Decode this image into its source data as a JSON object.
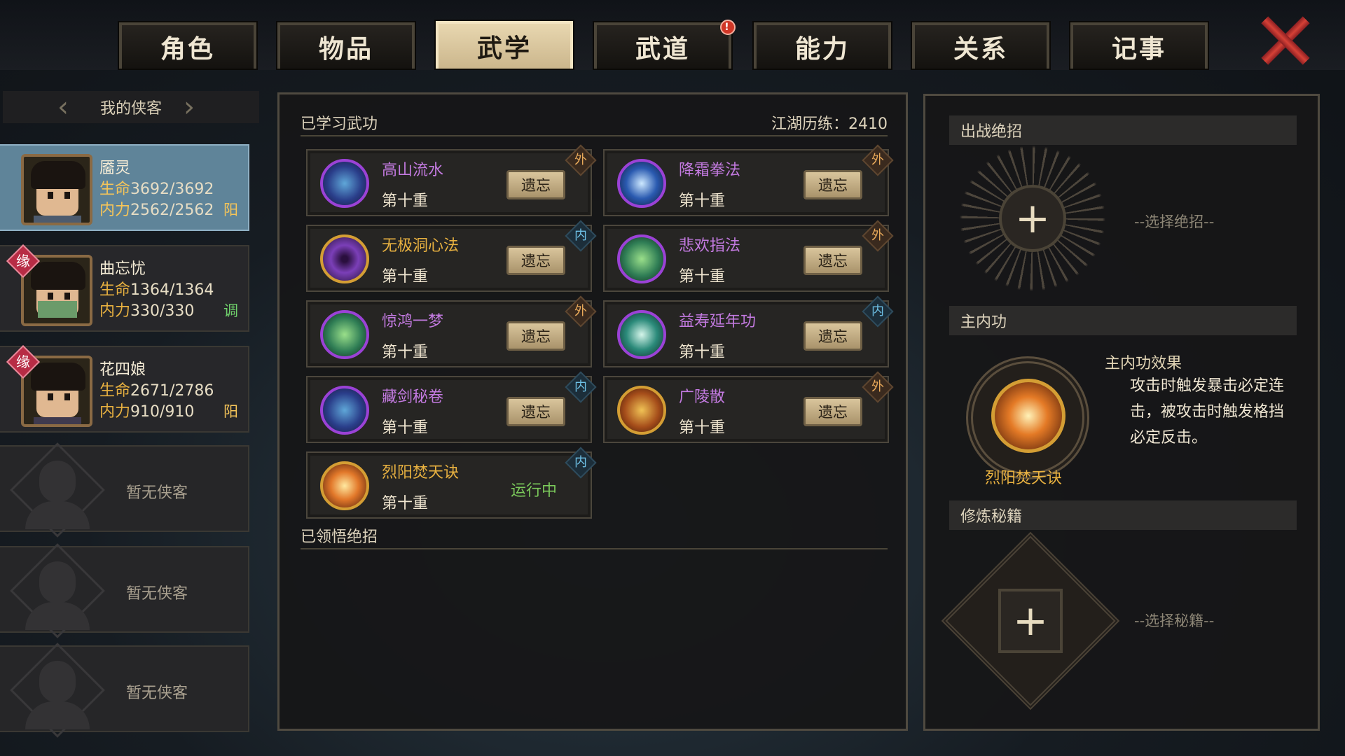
{
  "tabs": [
    {
      "label": "角色"
    },
    {
      "label": "物品"
    },
    {
      "label": "武学",
      "active": true
    },
    {
      "label": "武道",
      "badge": "!"
    },
    {
      "label": "能力"
    },
    {
      "label": "关系"
    },
    {
      "label": "记事"
    }
  ],
  "close_icon": "close-x-icon",
  "sidebar": {
    "title": "我的侠客",
    "heroes": [
      {
        "name": "靥灵",
        "life_label": "生命",
        "life": "3692/3692",
        "mp_label": "内力",
        "mp": "2562/2562",
        "tag": "阳",
        "tag_color": "#f6c559",
        "active": true
      },
      {
        "name": "曲忘忧",
        "life_label": "生命",
        "life": "1364/1364",
        "mp_label": "内力",
        "mp": "330/330",
        "tag": "调",
        "tag_color": "#6fd06b",
        "yuan": "缘"
      },
      {
        "name": "花四娘",
        "life_label": "生命",
        "life": "2671/2786",
        "mp_label": "内力",
        "mp": "910/910",
        "tag": "阳",
        "tag_color": "#f6c559",
        "yuan": "缘"
      }
    ],
    "empty_label": "暂无侠客"
  },
  "martial": {
    "title": "已学习武功",
    "jianghu": "江湖历练：2410",
    "forget_label": "遗忘",
    "skills": [
      {
        "name": "高山流水",
        "level": "第十重",
        "type": "外",
        "icon": "sword-scroll-icon"
      },
      {
        "name": "降霜拳法",
        "level": "第十重",
        "type": "外",
        "icon": "frost-fist-icon"
      },
      {
        "name": "无极洞心法",
        "level": "第十重",
        "type": "内",
        "icon": "vortex-icon"
      },
      {
        "name": "悲欢指法",
        "level": "第十重",
        "type": "外",
        "icon": "finger-strike-icon"
      },
      {
        "name": "惊鸿一梦",
        "level": "第十重",
        "type": "外",
        "icon": "jade-blade-icon"
      },
      {
        "name": "益寿延年功",
        "level": "第十重",
        "type": "内",
        "icon": "longevity-icon"
      },
      {
        "name": "藏剑秘卷",
        "level": "第十重",
        "type": "内",
        "icon": "hidden-sword-icon"
      },
      {
        "name": "广陵散",
        "level": "第十重",
        "type": "外",
        "icon": "zither-icon"
      },
      {
        "name": "烈阳焚天诀",
        "level": "第十重",
        "type": "内",
        "icon": "flame-icon",
        "status": "运行中"
      }
    ],
    "insight_title": "已领悟绝招"
  },
  "right": {
    "ultimate_title": "出战绝招",
    "ultimate_hint": "--选择绝招--",
    "main_title": "主内功",
    "main_skill": "烈阳焚天诀",
    "effect_title": "主内功效果",
    "effect_text": "攻击时触发暴击必定连击，被攻击时触发格挡必定反击。",
    "book_title": "修炼秘籍",
    "book_hint": "--选择秘籍--"
  }
}
